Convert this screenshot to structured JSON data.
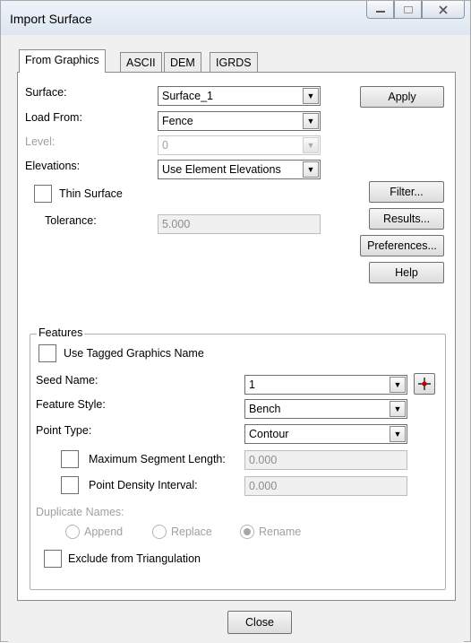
{
  "window": {
    "title": "Import Surface",
    "controls": {
      "minimize": "—",
      "maximize": "□",
      "close": "✕"
    }
  },
  "tabs": [
    {
      "label": "From Graphics",
      "active": true
    },
    {
      "label": "ASCII",
      "active": false
    },
    {
      "label": "DEM",
      "active": false
    },
    {
      "label": "IGRDS",
      "active": false
    }
  ],
  "form": {
    "surface_label": "Surface:",
    "surface_value": "Surface_1",
    "load_from_label": "Load From:",
    "load_from_value": "Fence",
    "level_label": "Level:",
    "level_value": "0",
    "elevations_label": "Elevations:",
    "elevations_value": "Use Element Elevations",
    "thin_surface_label": "Thin Surface",
    "thin_surface_checked": false,
    "tolerance_label": "Tolerance:",
    "tolerance_value": "5.000"
  },
  "side_buttons": {
    "apply": "Apply",
    "filter": "Filter...",
    "results": "Results...",
    "preferences": "Preferences...",
    "help": "Help"
  },
  "features": {
    "group_label": "Features",
    "use_tagged_label": "Use Tagged Graphics Name",
    "use_tagged_checked": false,
    "seed_name_label": "Seed Name:",
    "seed_name_value": "1",
    "feature_style_label": "Feature Style:",
    "feature_style_value": "Bench",
    "point_type_label": "Point Type:",
    "point_type_value": "Contour",
    "max_segment_label": "Maximum Segment Length:",
    "max_segment_value": "0.000",
    "max_segment_checked": false,
    "point_density_label": "Point Density Interval:",
    "point_density_value": "0.000",
    "point_density_checked": false,
    "duplicate_names_label": "Duplicate Names:",
    "duplicate_options": [
      {
        "label": "Append",
        "selected": false
      },
      {
        "label": "Replace",
        "selected": false
      },
      {
        "label": "Rename",
        "selected": true
      }
    ],
    "exclude_label": "Exclude from Triangulation",
    "exclude_checked": false
  },
  "footer": {
    "close_label": "Close"
  },
  "icons": {
    "dropdown": "▼",
    "target": "crosshair-target-icon"
  },
  "colors": {
    "window_bg": "#f0f0f0",
    "panel_bg": "#ffffff",
    "disabled_text": "#a0a0a0"
  }
}
